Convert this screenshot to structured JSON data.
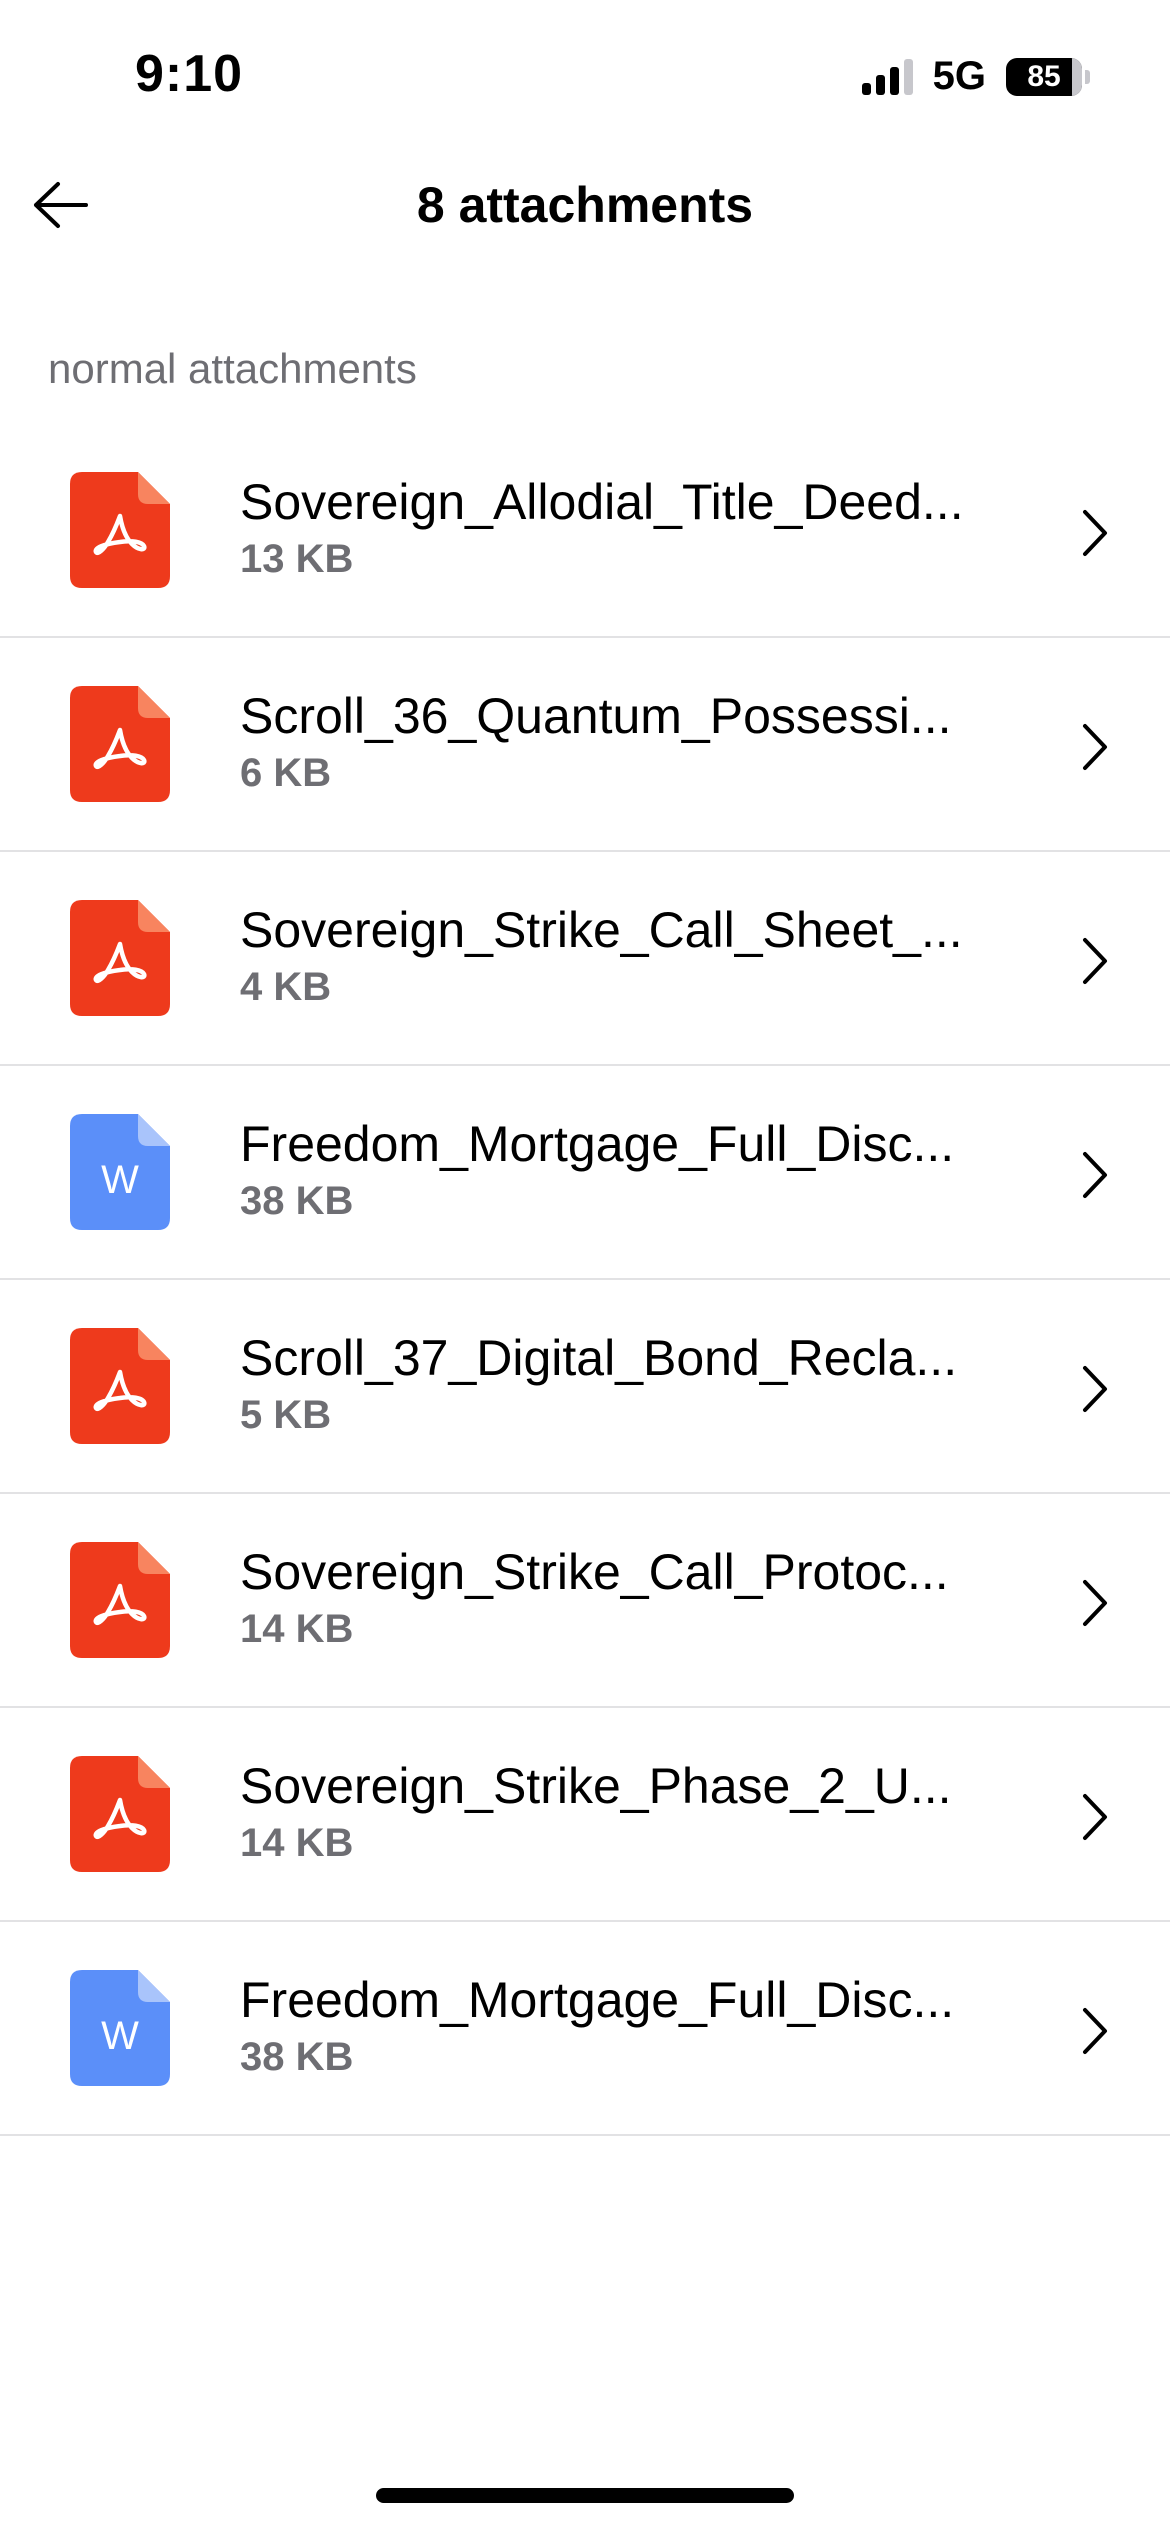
{
  "status_bar": {
    "time": "9:10",
    "network": "5G",
    "battery": "85"
  },
  "header": {
    "title": "8 attachments"
  },
  "section": {
    "label": "normal attachments"
  },
  "colors": {
    "pdf": "#ee3a1c",
    "pdf_fold": "#f8845f",
    "word": "#5b8ff9",
    "word_fold": "#a9c4fb"
  },
  "attachments": [
    {
      "name": "Sovereign_Allodial_Title_Deed...",
      "size": "13 KB",
      "type": "pdf",
      "icon": "pdf-file-icon"
    },
    {
      "name": "Scroll_36_Quantum_Possessi...",
      "size": "6 KB",
      "type": "pdf",
      "icon": "pdf-file-icon"
    },
    {
      "name": "Sovereign_Strike_Call_Sheet_...",
      "size": "4 KB",
      "type": "pdf",
      "icon": "pdf-file-icon"
    },
    {
      "name": "Freedom_Mortgage_Full_Disc...",
      "size": "38 KB",
      "type": "word",
      "icon": "word-file-icon",
      "glyph": "W"
    },
    {
      "name": "Scroll_37_Digital_Bond_Recla...",
      "size": "5 KB",
      "type": "pdf",
      "icon": "pdf-file-icon"
    },
    {
      "name": "Sovereign_Strike_Call_Protoc...",
      "size": "14 KB",
      "type": "pdf",
      "icon": "pdf-file-icon"
    },
    {
      "name": "Sovereign_Strike_Phase_2_U...",
      "size": "14 KB",
      "type": "pdf",
      "icon": "pdf-file-icon"
    },
    {
      "name": "Freedom_Mortgage_Full_Disc...",
      "size": "38 KB",
      "type": "word",
      "icon": "word-file-icon",
      "glyph": "W"
    }
  ]
}
